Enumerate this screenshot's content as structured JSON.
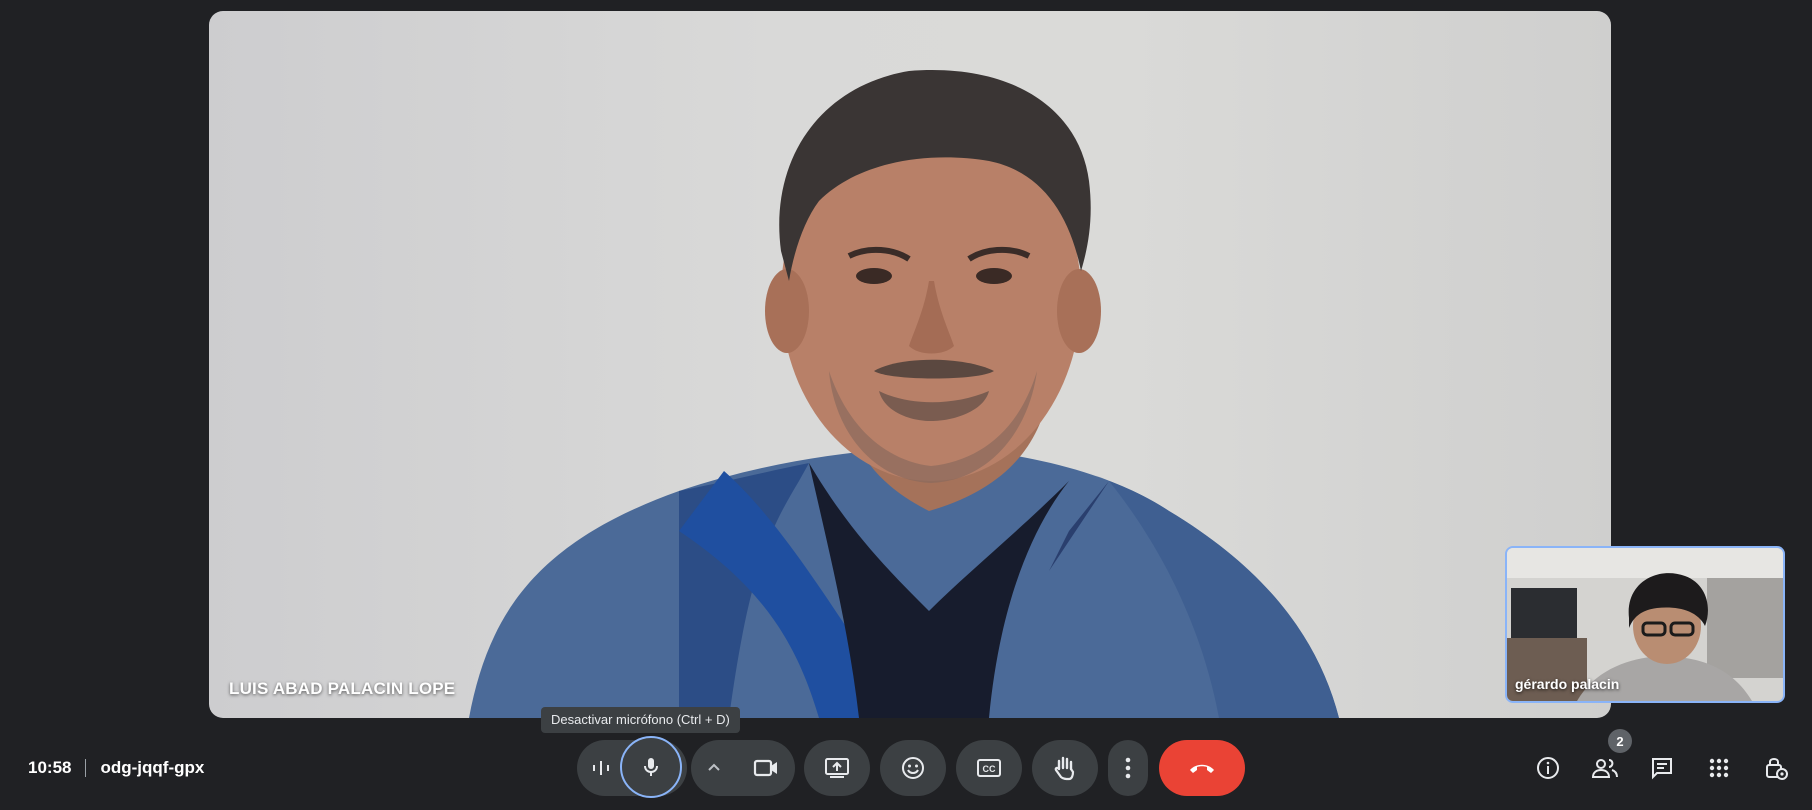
{
  "main_participant": {
    "name": "LUIS ABAD PALACIN LOPE"
  },
  "self_view": {
    "name": "gérardo palacin"
  },
  "tooltip": {
    "text": "Desactivar micrófono (Ctrl + D)"
  },
  "meeting": {
    "time": "10:58",
    "code": "odg-jqqf-gpx"
  },
  "people_count": "2",
  "controls": [
    "audio-levels-icon",
    "microphone-icon",
    "chevron-up-icon",
    "camera-icon",
    "present-screen-icon",
    "emoji-icon",
    "captions-icon",
    "raise-hand-icon",
    "more-options-icon",
    "end-call-icon"
  ],
  "right_icons": [
    "info-icon",
    "people-icon",
    "chat-icon",
    "activities-icon",
    "host-controls-icon"
  ],
  "colors": {
    "end_call": "#ea4335",
    "accent": "#8ab4f8",
    "button_bg": "#3c4043"
  }
}
